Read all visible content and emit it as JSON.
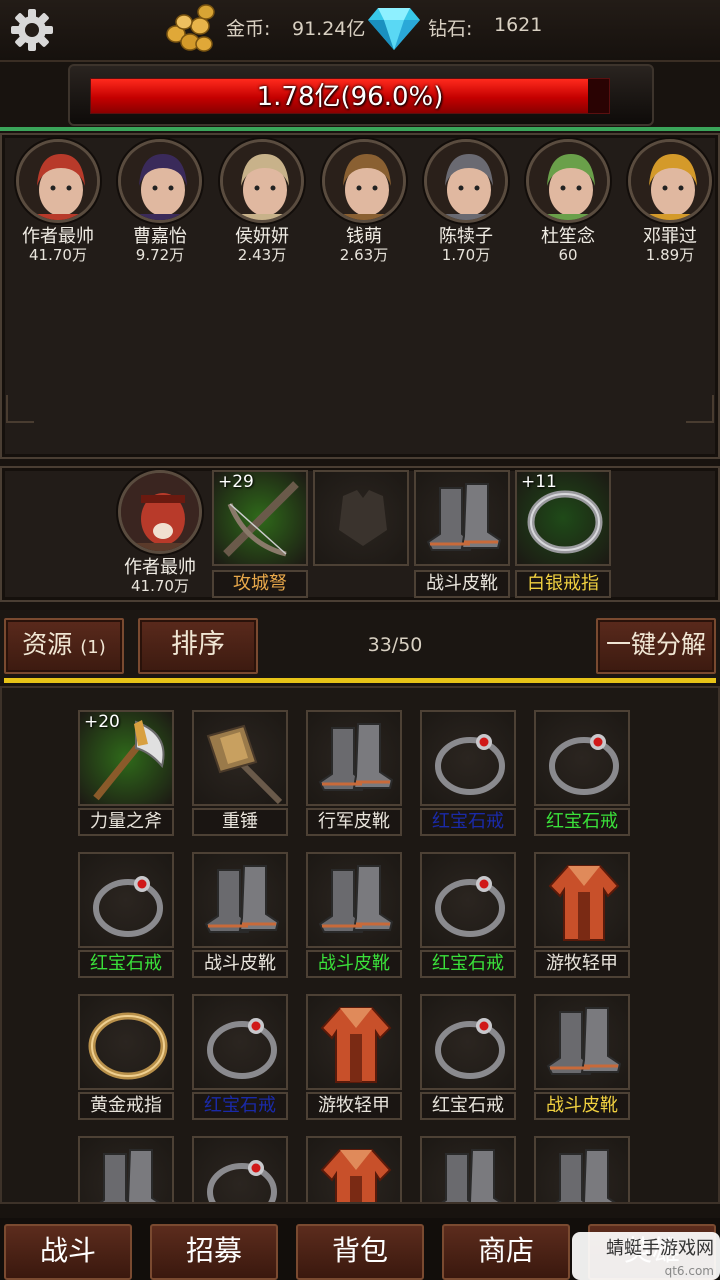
{
  "topbar": {
    "gold_label": "金币:",
    "gold_value": "91.24亿",
    "diamond_label": "钻石:",
    "diamond_value": "1621"
  },
  "boss": {
    "hp_text": "1.78亿(96.0%)",
    "hp_percent": 96.0
  },
  "heroes": [
    {
      "name": "作者最帅",
      "value": "41.70万",
      "color": "#b83a2a"
    },
    {
      "name": "曹嘉怡",
      "value": "9.72万",
      "color": "#3a2a5a"
    },
    {
      "name": "侯妍妍",
      "value": "2.43万",
      "color": "#c8b28a"
    },
    {
      "name": "钱萌",
      "value": "2.63万",
      "color": "#8a6032"
    },
    {
      "name": "陈犊子",
      "value": "1.70万",
      "color": "#6a6a72"
    },
    {
      "name": "杜笙念",
      "value": "60",
      "color": "#6aa04a"
    },
    {
      "name": "邓罪过",
      "value": "1.89万",
      "color": "#d49a2a"
    }
  ],
  "equip": {
    "hero_name": "作者最帅",
    "hero_value": "41.70万",
    "slots": [
      {
        "plus": "+29",
        "label": "攻城弩",
        "label_color": "#e8a84a",
        "icon": "crossbow-icon",
        "bg": "#2f6a1a"
      },
      {
        "plus": "",
        "label": "",
        "label_color": "#ffffff",
        "icon": "armor-empty-icon",
        "bg": "#2b2520"
      },
      {
        "plus": "",
        "label": "战斗皮靴",
        "label_color": "#e8e4dc",
        "icon": "boots-icon",
        "bg": "#2b2520"
      },
      {
        "plus": "+11",
        "label": "白银戒指",
        "label_color": "#f0d040",
        "icon": "ring-icon",
        "bg": "#1f4a18"
      }
    ]
  },
  "resbar": {
    "resource_label": "资源",
    "resource_count": "(1)",
    "sort_label": "排序",
    "capacity": "33/50",
    "decompose_label": "一键分解"
  },
  "inventory": [
    {
      "plus": "+20",
      "label": "力量之斧",
      "label_color": "#e8e4dc",
      "icon": "axe-icon",
      "bg": "#2f6a1a"
    },
    {
      "plus": "",
      "label": "重锤",
      "label_color": "#e8e4dc",
      "icon": "hammer-icon",
      "bg": "#2b2520"
    },
    {
      "plus": "",
      "label": "行军皮靴",
      "label_color": "#e8e4dc",
      "icon": "boots-icon",
      "bg": "#2b2520"
    },
    {
      "plus": "",
      "label": "红宝石戒",
      "label_color": "#1a2aa8",
      "icon": "ruby-ring-icon",
      "bg": "#2b2520"
    },
    {
      "plus": "",
      "label": "红宝石戒",
      "label_color": "#3ae03a",
      "icon": "ruby-ring-icon",
      "bg": "#2b2520"
    },
    {
      "plus": "",
      "label": "红宝石戒",
      "label_color": "#3ae03a",
      "icon": "ruby-ring-icon",
      "bg": "#2b2520"
    },
    {
      "plus": "",
      "label": "战斗皮靴",
      "label_color": "#e8e4dc",
      "icon": "boots-icon",
      "bg": "#2b2520"
    },
    {
      "plus": "",
      "label": "战斗皮靴",
      "label_color": "#3ae03a",
      "icon": "boots-icon",
      "bg": "#2b2520"
    },
    {
      "plus": "",
      "label": "红宝石戒",
      "label_color": "#3ae03a",
      "icon": "ruby-ring-icon",
      "bg": "#2b2520"
    },
    {
      "plus": "",
      "label": "游牧轻甲",
      "label_color": "#e8e4dc",
      "icon": "robe-icon",
      "bg": "#2b2520"
    },
    {
      "plus": "",
      "label": "黄金戒指",
      "label_color": "#e8e4dc",
      "icon": "gold-ring-icon",
      "bg": "#2b2520"
    },
    {
      "plus": "",
      "label": "红宝石戒",
      "label_color": "#1a2aa8",
      "icon": "ruby-ring-icon",
      "bg": "#2b2520"
    },
    {
      "plus": "",
      "label": "游牧轻甲",
      "label_color": "#e8e4dc",
      "icon": "robe-icon",
      "bg": "#2b2520"
    },
    {
      "plus": "",
      "label": "红宝石戒",
      "label_color": "#e8e4dc",
      "icon": "ruby-ring-icon",
      "bg": "#2b2520"
    },
    {
      "plus": "",
      "label": "战斗皮靴",
      "label_color": "#f0d040",
      "icon": "boots-icon",
      "bg": "#2b2520"
    },
    {
      "plus": "",
      "label": "",
      "label_color": "#e8e4dc",
      "icon": "boots-icon",
      "bg": "#2b2520"
    },
    {
      "plus": "",
      "label": "",
      "label_color": "#e8e4dc",
      "icon": "ruby-ring-icon",
      "bg": "#2b2520"
    },
    {
      "plus": "",
      "label": "",
      "label_color": "#e8e4dc",
      "icon": "robe-icon",
      "bg": "#2b2520"
    },
    {
      "plus": "",
      "label": "",
      "label_color": "#e8e4dc",
      "icon": "boots-icon",
      "bg": "#2b2520"
    },
    {
      "plus": "",
      "label": "",
      "label_color": "#e8e4dc",
      "icon": "boots-icon",
      "bg": "#2b2520"
    }
  ],
  "nav": {
    "items": [
      "战斗",
      "招募",
      "背包",
      "商店",
      "英雄"
    ]
  },
  "watermark": {
    "line1": "蜻蜓手游戏网",
    "line2": "qt6.com"
  }
}
